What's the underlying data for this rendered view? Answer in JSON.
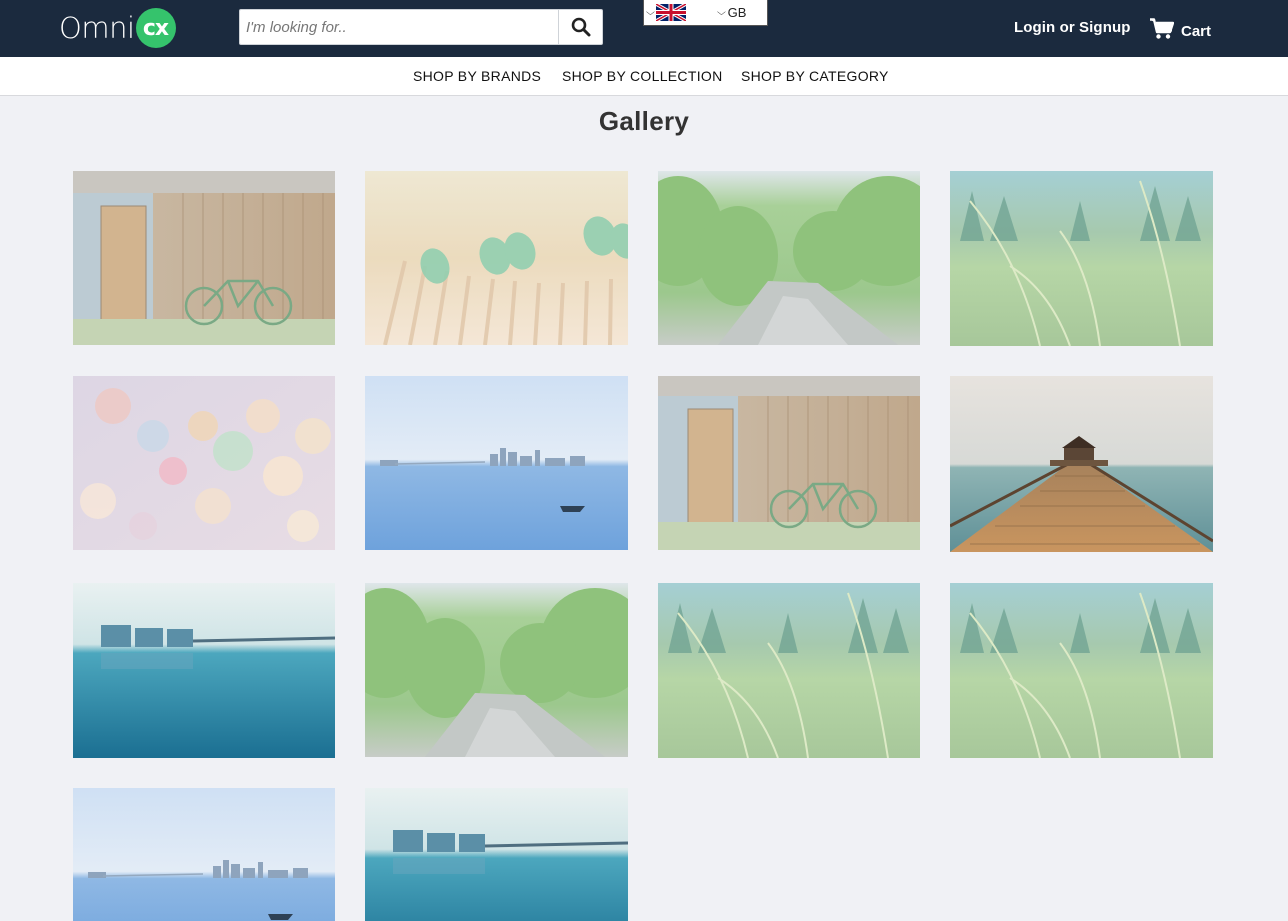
{
  "brand": {
    "logo_text": "Omni",
    "logo_badge": "cx"
  },
  "search": {
    "placeholder": "I'm looking for.."
  },
  "locale": {
    "code": "GB",
    "flag": "uk-flag-icon"
  },
  "header": {
    "login_label": "Login or Signup",
    "cart_label": "Cart"
  },
  "nav": {
    "items": [
      {
        "label": "SHOP BY BRANDS"
      },
      {
        "label": "SHOP BY COLLECTION"
      },
      {
        "label": "SHOP BY CATEGORY"
      }
    ]
  },
  "page": {
    "title": "Gallery"
  },
  "colors": {
    "topbar": "#1b2a3e",
    "accent": "#35c36c",
    "background": "#f0f1f5"
  },
  "gallery": {
    "images": [
      {
        "subject": "wooden-shed-with-bicycle"
      },
      {
        "subject": "green-bottles-on-fence"
      },
      {
        "subject": "forest-stream"
      },
      {
        "subject": "grass-field"
      },
      {
        "subject": "bokeh-lights"
      },
      {
        "subject": "bay-city-skyline-boat"
      },
      {
        "subject": "wooden-shed-with-bicycle"
      },
      {
        "subject": "pier-with-gazebo"
      },
      {
        "subject": "lake-with-buildings"
      },
      {
        "subject": "forest-stream"
      },
      {
        "subject": "grass-field"
      },
      {
        "subject": "grass-field"
      },
      {
        "subject": "bay-city-skyline-boat"
      },
      {
        "subject": "lake-with-buildings"
      }
    ]
  }
}
